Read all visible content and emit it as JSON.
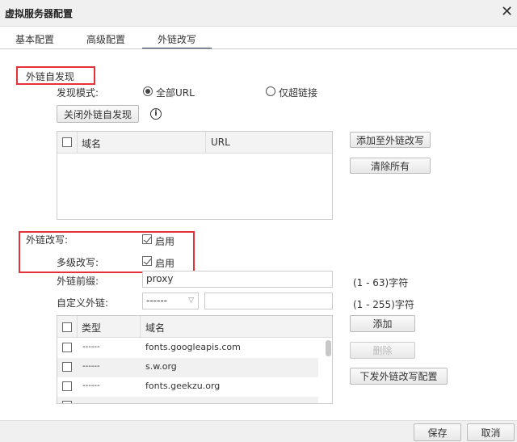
{
  "window": {
    "title": "虚拟服务器配置"
  },
  "tabs": [
    {
      "label": "基本配置"
    },
    {
      "label": "高级配置"
    },
    {
      "label": "外链改写"
    }
  ],
  "discovery": {
    "section_title": "外链自发现",
    "mode_label": "发现模式:",
    "mode_options": [
      {
        "label": "全部URL",
        "selected": true
      },
      {
        "label": "仅超链接",
        "selected": false
      }
    ],
    "toggle_button": "关闭外链自发现",
    "table_headers": [
      "域名",
      "URL"
    ],
    "add_button": "添加至外链改写",
    "clear_button": "清除所有"
  },
  "rewrite": {
    "rewrite_label": "外链改写:",
    "rewrite_enabled": true,
    "enable_text": "启用",
    "multilevel_label": "多级改写:",
    "multilevel_enabled": true,
    "prefix_label": "外链前缀:",
    "prefix_value": "proxy",
    "prefix_hint": "(1 - 63)字符",
    "custom_label": "自定义外链:",
    "custom_select": "------",
    "custom_value": "",
    "custom_hint": "(1 - 255)字符",
    "table_headers": [
      "类型",
      "域名"
    ],
    "rows": [
      {
        "type": "------",
        "domain": "fonts.googleapis.com"
      },
      {
        "type": "------",
        "domain": "s.w.org"
      },
      {
        "type": "------",
        "domain": "fonts.geekzu.org"
      }
    ],
    "add_button": "添加",
    "delete_button": "删除",
    "push_button": "下发外链改写配置"
  },
  "footer": {
    "save": "保存",
    "cancel": "取消"
  }
}
